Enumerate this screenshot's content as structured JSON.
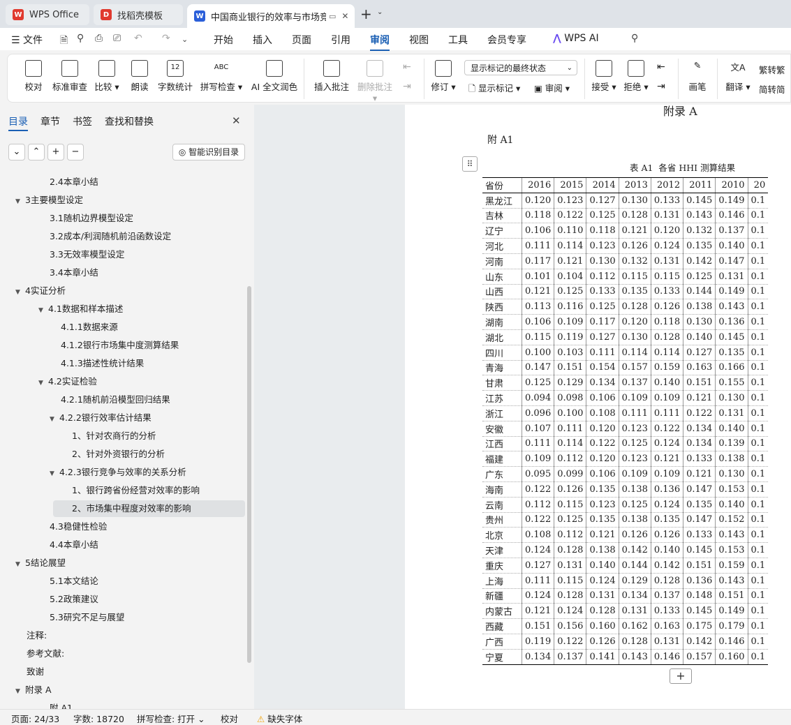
{
  "tabs": [
    {
      "label": "WPS Office",
      "logo": "W",
      "logo_color": "#e03a2f"
    },
    {
      "label": "找稻壳模板",
      "logo": "D",
      "logo_color": "#e03a2f"
    },
    {
      "label": "中国商业银行的效率与市场竞",
      "logo": "W",
      "logo_color": "#2b5fd9"
    }
  ],
  "menu": {
    "file": "文件",
    "items": [
      "开始",
      "插入",
      "页面",
      "引用",
      "审阅",
      "视图",
      "工具",
      "会员专享"
    ],
    "active": "审阅",
    "ai": "WPS AI"
  },
  "ribbon": {
    "buttons": [
      "校对",
      "标准审查",
      "比较",
      "朗读",
      "字数统计",
      "拼写检查",
      "AI 全文润色",
      "插入批注",
      "删除批注",
      "修订",
      "接受",
      "拒绝",
      "画笔",
      "翻译"
    ],
    "display_select": "显示标记的最终状态",
    "show_markup": "显示标记",
    "review": "审阅",
    "to_trad": "转繁",
    "to_simp": "转简",
    "count_icon_text": "12",
    "spell_icon_text": "ABC"
  },
  "panel": {
    "tabs": [
      "目录",
      "章节",
      "书签",
      "查找和替换"
    ],
    "smart_btn": "智能识别目录",
    "toc": [
      {
        "label": "2.4本章小结",
        "level": 2
      },
      {
        "label": "3主要模型设定",
        "level": 1,
        "expand": true
      },
      {
        "label": "3.1随机边界模型设定",
        "level": 2
      },
      {
        "label": "3.2成本/利润随机前沿函数设定",
        "level": 2
      },
      {
        "label": "3.3无效率模型设定",
        "level": 2
      },
      {
        "label": "3.4本章小结",
        "level": 2
      },
      {
        "label": "4实证分析",
        "level": 1,
        "expand": true
      },
      {
        "label": "4.1数据和样本描述",
        "level": 2,
        "expand": true
      },
      {
        "label": "4.1.1数据来源",
        "level": 3
      },
      {
        "label": "4.1.2银行市场集中度测算结果",
        "level": 3
      },
      {
        "label": "4.1.3描述性统计结果",
        "level": 3
      },
      {
        "label": "4.2实证检验",
        "level": 2,
        "expand": true
      },
      {
        "label": "4.2.1随机前沿模型回归结果",
        "level": 3
      },
      {
        "label": "4.2.2银行效率估计结果",
        "level": 3,
        "expand": true
      },
      {
        "label": "1、针对农商行的分析",
        "level": 4
      },
      {
        "label": "2、针对外资银行的分析",
        "level": 4
      },
      {
        "label": "4.2.3银行竞争与效率的关系分析",
        "level": 3,
        "expand": true
      },
      {
        "label": "1、银行跨省份经营对效率的影响",
        "level": 4
      },
      {
        "label": "2、市场集中程度对效率的影响",
        "level": 4,
        "selected": true
      },
      {
        "label": "4.3稳健性检验",
        "level": 2
      },
      {
        "label": "4.4本章小结",
        "level": 2
      },
      {
        "label": "5结论展望",
        "level": 1,
        "expand": true
      },
      {
        "label": "5.1本文结论",
        "level": 2
      },
      {
        "label": "5.2政策建议",
        "level": 2
      },
      {
        "label": "5.3研究不足与展望",
        "level": 2
      },
      {
        "label": "注释:",
        "level": 1
      },
      {
        "label": "参考文献:",
        "level": 1
      },
      {
        "label": "致谢",
        "level": 1
      },
      {
        "label": "附录 A",
        "level": 1,
        "expand": true
      },
      {
        "label": "附 A1",
        "level": 2
      }
    ]
  },
  "doc": {
    "heading": "附录 A",
    "subheading": "附 A1",
    "caption": "表 A1  各省 HHI 测算结果",
    "headers": [
      "省份",
      "2016",
      "2015",
      "2014",
      "2013",
      "2012",
      "2011",
      "2010",
      "20"
    ],
    "rows": [
      [
        "黑龙江",
        "0.120",
        "0.123",
        "0.127",
        "0.130",
        "0.133",
        "0.145",
        "0.149",
        "0.1"
      ],
      [
        "吉林",
        "0.118",
        "0.122",
        "0.125",
        "0.128",
        "0.131",
        "0.143",
        "0.146",
        "0.1"
      ],
      [
        "辽宁",
        "0.106",
        "0.110",
        "0.118",
        "0.121",
        "0.120",
        "0.132",
        "0.137",
        "0.1"
      ],
      [
        "河北",
        "0.111",
        "0.114",
        "0.123",
        "0.126",
        "0.124",
        "0.135",
        "0.140",
        "0.1"
      ],
      [
        "河南",
        "0.117",
        "0.121",
        "0.130",
        "0.132",
        "0.131",
        "0.142",
        "0.147",
        "0.1"
      ],
      [
        "山东",
        "0.101",
        "0.104",
        "0.112",
        "0.115",
        "0.115",
        "0.125",
        "0.131",
        "0.1"
      ],
      [
        "山西",
        "0.121",
        "0.125",
        "0.133",
        "0.135",
        "0.133",
        "0.144",
        "0.149",
        "0.1"
      ],
      [
        "陕西",
        "0.113",
        "0.116",
        "0.125",
        "0.128",
        "0.126",
        "0.138",
        "0.143",
        "0.1"
      ],
      [
        "湖南",
        "0.106",
        "0.109",
        "0.117",
        "0.120",
        "0.118",
        "0.130",
        "0.136",
        "0.1"
      ],
      [
        "湖北",
        "0.115",
        "0.119",
        "0.127",
        "0.130",
        "0.128",
        "0.140",
        "0.145",
        "0.1"
      ],
      [
        "四川",
        "0.100",
        "0.103",
        "0.111",
        "0.114",
        "0.114",
        "0.127",
        "0.135",
        "0.1"
      ],
      [
        "青海",
        "0.147",
        "0.151",
        "0.154",
        "0.157",
        "0.159",
        "0.163",
        "0.166",
        "0.1"
      ],
      [
        "甘肃",
        "0.125",
        "0.129",
        "0.134",
        "0.137",
        "0.140",
        "0.151",
        "0.155",
        "0.1"
      ],
      [
        "江苏",
        "0.094",
        "0.098",
        "0.106",
        "0.109",
        "0.109",
        "0.121",
        "0.130",
        "0.1"
      ],
      [
        "浙江",
        "0.096",
        "0.100",
        "0.108",
        "0.111",
        "0.111",
        "0.122",
        "0.131",
        "0.1"
      ],
      [
        "安徽",
        "0.107",
        "0.111",
        "0.120",
        "0.123",
        "0.122",
        "0.134",
        "0.140",
        "0.1"
      ],
      [
        "江西",
        "0.111",
        "0.114",
        "0.122",
        "0.125",
        "0.124",
        "0.134",
        "0.139",
        "0.1"
      ],
      [
        "福建",
        "0.109",
        "0.112",
        "0.120",
        "0.123",
        "0.121",
        "0.133",
        "0.138",
        "0.1"
      ],
      [
        "广东",
        "0.095",
        "0.099",
        "0.106",
        "0.109",
        "0.109",
        "0.121",
        "0.130",
        "0.1"
      ],
      [
        "海南",
        "0.122",
        "0.126",
        "0.135",
        "0.138",
        "0.136",
        "0.147",
        "0.153",
        "0.1"
      ],
      [
        "云南",
        "0.112",
        "0.115",
        "0.123",
        "0.125",
        "0.124",
        "0.135",
        "0.140",
        "0.1"
      ],
      [
        "贵州",
        "0.122",
        "0.125",
        "0.135",
        "0.138",
        "0.135",
        "0.147",
        "0.152",
        "0.1"
      ],
      [
        "北京",
        "0.108",
        "0.112",
        "0.121",
        "0.126",
        "0.126",
        "0.133",
        "0.143",
        "0.1"
      ],
      [
        "天津",
        "0.124",
        "0.128",
        "0.138",
        "0.142",
        "0.140",
        "0.145",
        "0.153",
        "0.1"
      ],
      [
        "重庆",
        "0.127",
        "0.131",
        "0.140",
        "0.144",
        "0.142",
        "0.151",
        "0.159",
        "0.1"
      ],
      [
        "上海",
        "0.111",
        "0.115",
        "0.124",
        "0.129",
        "0.128",
        "0.136",
        "0.143",
        "0.1"
      ],
      [
        "新疆",
        "0.124",
        "0.128",
        "0.131",
        "0.134",
        "0.137",
        "0.148",
        "0.151",
        "0.1"
      ],
      [
        "内蒙古",
        "0.121",
        "0.124",
        "0.128",
        "0.131",
        "0.133",
        "0.145",
        "0.149",
        "0.1"
      ],
      [
        "西藏",
        "0.151",
        "0.156",
        "0.160",
        "0.162",
        "0.163",
        "0.175",
        "0.179",
        "0.1"
      ],
      [
        "广西",
        "0.119",
        "0.122",
        "0.126",
        "0.128",
        "0.131",
        "0.142",
        "0.146",
        "0.1"
      ],
      [
        "宁夏",
        "0.134",
        "0.137",
        "0.141",
        "0.143",
        "0.146",
        "0.157",
        "0.160",
        "0.1"
      ]
    ]
  },
  "status": {
    "page": "页面: 24/33",
    "words": "字数: 18720",
    "spell": "拼写检查: 打开",
    "proof": "校对",
    "missing_font": "缺失字体"
  },
  "colors": {
    "accent": "#1a5fb4",
    "warning": "#f0a30a"
  }
}
